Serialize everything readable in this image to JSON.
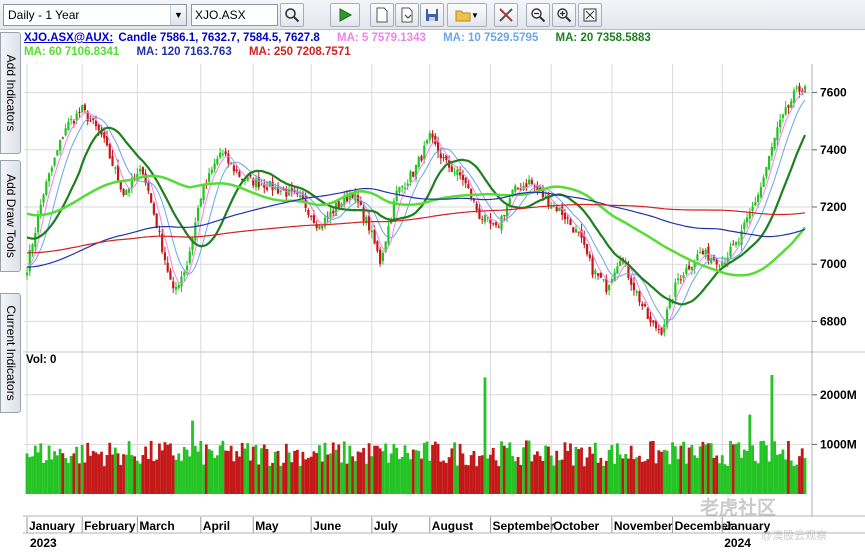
{
  "toolbar": {
    "period": "Daily - 1 Year",
    "symbol": "XJO.ASX",
    "buttons": [
      "play-icon",
      "new-chart-icon",
      "open-chart-icon",
      "save-icon",
      "open-folder-icon",
      "dropdown-icon",
      "tools-icon",
      "zoom-out-icon",
      "zoom-in-icon",
      "fit-icon"
    ]
  },
  "side_tabs": [
    "Add Indicators",
    "Add Draw Tools",
    "Current Indicators"
  ],
  "legend": {
    "symbol": "XJO.ASX@AUX:",
    "candle": "Candle 7586.1, 7632.7, 7584.5, 7627.8",
    "ma5": "MA: 5 7579.1343",
    "ma10": "MA: 10 7529.5795",
    "ma20": "MA: 20 7358.5883",
    "ma60": "MA: 60 7106.8341",
    "ma120": "MA: 120 7163.763",
    "ma250": "MA: 250 7208.7571"
  },
  "volume_label": "Vol: 0",
  "colors": {
    "up": "#22c322",
    "down": "#c41818",
    "ma5": "#ee82ee",
    "ma10": "#6aa6e8",
    "ma20": "#1e7f1e",
    "ma60": "#55dd33",
    "ma120": "#2233aa",
    "ma250": "#d42020",
    "grid": "#d9d9d9",
    "symbol": "#0000cc"
  },
  "watermark": "老虎社区",
  "watermark_sub": "@澳股云观察",
  "chart_data": {
    "type": "candlestick",
    "price_axis": {
      "ticks": [
        7600,
        7400,
        7200,
        7000,
        6800
      ],
      "labels": [
        "7600",
        "7400",
        "7200",
        "7000",
        "6800"
      ],
      "ylim": [
        6700,
        7700
      ]
    },
    "volume_axis": {
      "ticks": [
        2000,
        1000
      ],
      "labels": [
        "2000M",
        "1000M"
      ],
      "ylim": [
        0,
        2500
      ]
    },
    "months": [
      "January",
      "February",
      "March",
      "April",
      "May",
      "June",
      "July",
      "August",
      "September",
      "October",
      "November",
      "December",
      "January"
    ],
    "years": [
      "2023",
      "2024"
    ],
    "close_keypoints": [
      [
        0,
        6990
      ],
      [
        6,
        7250
      ],
      [
        14,
        7480
      ],
      [
        20,
        7540
      ],
      [
        27,
        7450
      ],
      [
        35,
        7250
      ],
      [
        42,
        7330
      ],
      [
        48,
        7100
      ],
      [
        53,
        6900
      ],
      [
        58,
        7000
      ],
      [
        63,
        7240
      ],
      [
        70,
        7390
      ],
      [
        78,
        7300
      ],
      [
        86,
        7280
      ],
      [
        94,
        7250
      ],
      [
        100,
        7220
      ],
      [
        106,
        7130
      ],
      [
        112,
        7200
      ],
      [
        118,
        7250
      ],
      [
        124,
        7130
      ],
      [
        128,
        7010
      ],
      [
        134,
        7250
      ],
      [
        140,
        7320
      ],
      [
        146,
        7440
      ],
      [
        152,
        7350
      ],
      [
        158,
        7300
      ],
      [
        164,
        7170
      ],
      [
        170,
        7120
      ],
      [
        176,
        7250
      ],
      [
        182,
        7290
      ],
      [
        188,
        7230
      ],
      [
        194,
        7180
      ],
      [
        200,
        7100
      ],
      [
        205,
        6980
      ],
      [
        210,
        6920
      ],
      [
        215,
        7030
      ],
      [
        220,
        6920
      ],
      [
        226,
        6790
      ],
      [
        230,
        6770
      ],
      [
        236,
        6950
      ],
      [
        244,
        7040
      ],
      [
        252,
        7010
      ],
      [
        258,
        7080
      ],
      [
        266,
        7270
      ],
      [
        272,
        7470
      ],
      [
        278,
        7590
      ],
      [
        282,
        7628
      ]
    ],
    "volume_spikes": [
      [
        166,
        2350
      ],
      [
        262,
        1600
      ],
      [
        270,
        2400
      ],
      [
        60,
        1480
      ]
    ]
  }
}
